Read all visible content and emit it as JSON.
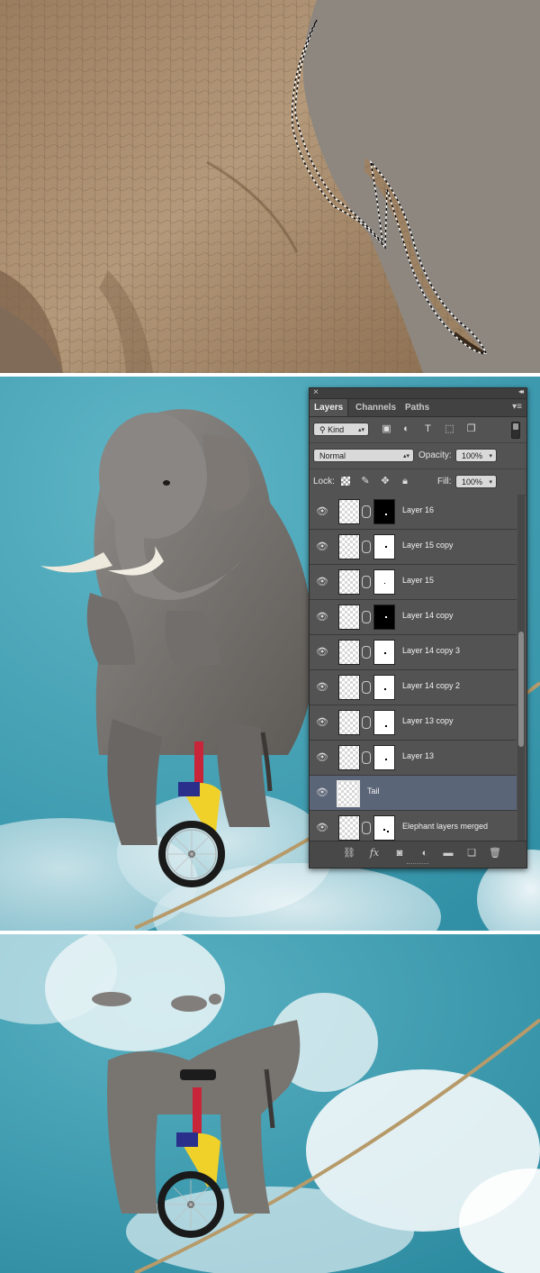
{
  "layers_panel": {
    "tabs": [
      "Layers",
      "Channels",
      "Paths"
    ],
    "active_tab": "Layers",
    "filter_kind": "Kind",
    "blend_mode": "Normal",
    "opacity_label": "Opacity:",
    "opacity_value": "100%",
    "lock_label": "Lock:",
    "fill_label": "Fill:",
    "fill_value": "100%",
    "layers": [
      {
        "name": "Layer 16",
        "mask": "black",
        "visible": true
      },
      {
        "name": "Layer 15 copy",
        "mask": "white",
        "visible": true
      },
      {
        "name": "Layer 15",
        "mask": "white",
        "visible": true
      },
      {
        "name": "Layer 14 copy",
        "mask": "black",
        "visible": true
      },
      {
        "name": "Layer 14 copy 3",
        "mask": "white",
        "visible": true
      },
      {
        "name": "Layer 14 copy 2",
        "mask": "white",
        "visible": true
      },
      {
        "name": "Layer 13 copy",
        "mask": "white",
        "visible": true
      },
      {
        "name": "Layer 13",
        "mask": "white",
        "visible": true
      },
      {
        "name": "Tail",
        "mask": "none",
        "visible": true,
        "selected": true
      },
      {
        "name": "Elephant layers merged",
        "mask": "white",
        "visible": true
      }
    ],
    "icons": {
      "close": "close-icon",
      "collapse": "collapse-icon",
      "menu": "panel-menu-icon",
      "eye": "eye-icon",
      "link": "link-icon",
      "fx": "fx-icon",
      "add_mask": "add-mask-icon",
      "adjustment": "adjustment-layer-icon",
      "group": "new-group-icon",
      "new_layer": "new-layer-icon",
      "trash": "trash-icon"
    },
    "bottom_fx": "fx"
  },
  "colors": {
    "panel_bg": "#535353",
    "selected_row": "#5b6578",
    "sky": "#3f9cb0",
    "backdrop": "#8d8780"
  }
}
